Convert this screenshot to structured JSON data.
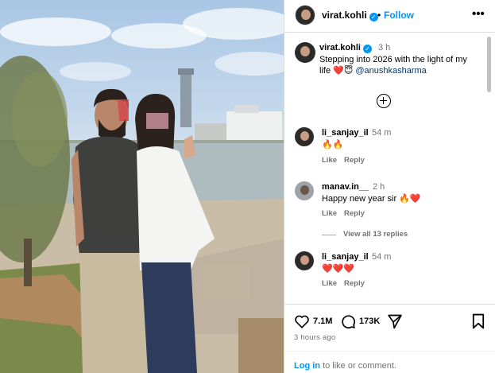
{
  "header": {
    "username": "virat.kohli",
    "separator": "•",
    "follow_label": "Follow",
    "more_label": "•••"
  },
  "caption": {
    "username": "virat.kohli",
    "time": "3 h",
    "text": "Stepping into 2026 with the light of my life",
    "emojis": "❤️😇",
    "mention": "@anushkasharma"
  },
  "comments": [
    {
      "username": "li_sanjay_il",
      "time": "54 m",
      "text": "🔥🔥",
      "like_label": "Like",
      "reply_label": "Reply"
    },
    {
      "username": "manav.in__",
      "time": "2 h",
      "text": "Happy new year sir 🔥❤️",
      "like_label": "Like",
      "reply_label": "Reply"
    },
    {
      "username": "li_sanjay_il",
      "time": "54 m",
      "text": "❤️❤️❤️",
      "like_label": "Like",
      "reply_label": "Reply"
    }
  ],
  "view_all_label": "View all 13 replies",
  "actions": {
    "like_count": "7.1M",
    "comment_count": "173K",
    "posted_ago": "3 hours ago"
  },
  "login": {
    "link_label": "Log in",
    "suffix": "to like or comment."
  },
  "colors": {
    "accent": "#0095f6",
    "muted": "#737373",
    "border": "#dbdbdb"
  },
  "icons": [
    "verified-badge-icon",
    "more-options-icon",
    "add-comment-icon",
    "heart-icon",
    "comment-icon",
    "share-icon",
    "save-bookmark-icon"
  ]
}
